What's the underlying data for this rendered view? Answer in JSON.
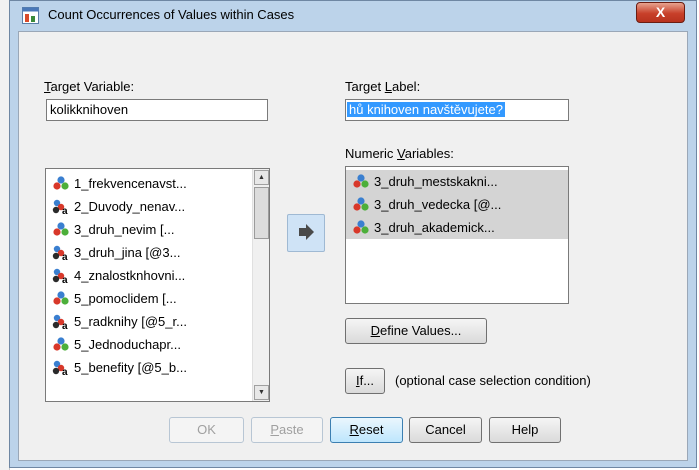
{
  "window": {
    "title": "Count Occurrences of Values within Cases",
    "close_glyph": "X"
  },
  "target_variable": {
    "label_underlined": "T",
    "label_rest": "arget Variable:",
    "value": "kolikknihoven"
  },
  "target_label": {
    "label_pre": "Target ",
    "label_underlined": "L",
    "label_rest": "abel:",
    "value": "hů knihoven navštěvujete?"
  },
  "source_list": {
    "items": [
      {
        "label": "1_frekvencenavst...",
        "icon": "scale-icon"
      },
      {
        "label": "2_Duvody_nenav...",
        "icon": "nominal-string-icon"
      },
      {
        "label": "3_druh_nevim [...",
        "icon": "scale-icon"
      },
      {
        "label": "3_druh_jina [@3...",
        "icon": "nominal-string-icon"
      },
      {
        "label": "4_znalostknhovni...",
        "icon": "nominal-string-icon"
      },
      {
        "label": "5_pomoclidem [...",
        "icon": "scale-icon"
      },
      {
        "label": "5_radknihy [@5_r...",
        "icon": "nominal-string-icon"
      },
      {
        "label": "5_Jednoduchapr...",
        "icon": "scale-icon"
      },
      {
        "label": "5_benefity [@5_b...",
        "icon": "nominal-string-icon"
      }
    ],
    "scroll_up_glyph": "▲",
    "scroll_down_glyph": "▼"
  },
  "numeric_variables": {
    "label_pre": "Numeric ",
    "label_underlined": "V",
    "label_rest": "ariables:",
    "items": [
      {
        "label": "3_druh_mestskakni...",
        "icon": "scale-icon"
      },
      {
        "label": "3_druh_vedecka [@...",
        "icon": "scale-icon"
      },
      {
        "label": "3_druh_akademick...",
        "icon": "scale-icon"
      }
    ]
  },
  "define_values": {
    "underlined": "D",
    "rest": "efine Values..."
  },
  "if_button": {
    "underlined": "I",
    "rest": "f..."
  },
  "if_hint": "(optional case selection condition)",
  "buttons": {
    "ok": "OK",
    "paste_underlined": "P",
    "paste_rest": "aste",
    "reset_underlined": "R",
    "reset_rest": "eset",
    "cancel": "Cancel",
    "help": "Help"
  },
  "colors": {
    "frame": "#bcd3ea",
    "selection": "#3399ff",
    "close_button": "#c8402a"
  }
}
